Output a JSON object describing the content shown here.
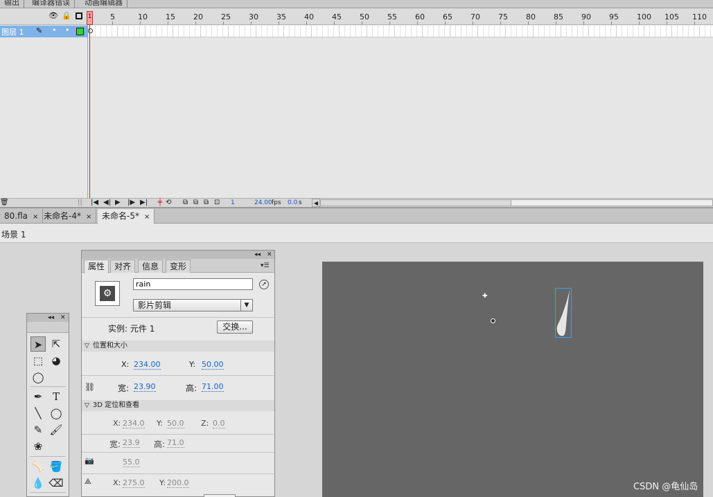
{
  "top_tabs": [
    "输出",
    "编译器错误",
    "动画编辑器"
  ],
  "timeline": {
    "ruler_numbers": [
      1,
      5,
      10,
      15,
      20,
      25,
      30,
      35,
      40,
      45,
      50,
      55,
      60,
      65,
      70,
      75,
      80,
      85,
      90,
      95,
      100,
      105,
      110
    ],
    "playhead_frame": "1",
    "layer": {
      "name": "图层 1"
    },
    "controls": {
      "current_frame": "1",
      "fps": "24.00",
      "fps_unit": "fps",
      "elapsed": "0.0",
      "elapsed_unit": "s"
    }
  },
  "doc_tabs": [
    {
      "label": "80.fla",
      "close": "×"
    },
    {
      "label": "未命名-4*",
      "close": "×"
    },
    {
      "label": "未命名-5*",
      "close": "×"
    }
  ],
  "scene": {
    "label": "场景 1"
  },
  "properties": {
    "tabs": [
      "属性",
      "对齐",
      "信息",
      "变形"
    ],
    "instance_name": "rain",
    "symbol_type": "影片剪辑",
    "instance_label": "实例:",
    "instance_value": "元件 1",
    "swap_button": "交换...",
    "position_section": "位置和大小",
    "pos": {
      "x_label": "X:",
      "x": "234.00",
      "y_label": "Y:",
      "y": "50.00"
    },
    "size": {
      "w_label": "宽:",
      "w": "23.90",
      "h_label": "高:",
      "h": "71.00"
    },
    "position_3d_section": "3D 定位和查看",
    "pos3d": {
      "x_label": "X:",
      "x": "234.0",
      "y_label": "Y:",
      "y": "50.0",
      "z_label": "Z:",
      "z": "0.0"
    },
    "size3d": {
      "w_label": "宽:",
      "w": "23.9",
      "h_label": "高:",
      "h": "71.0"
    },
    "perspective_angle": "55.0",
    "vanishing": {
      "x_label": "X:",
      "x": "275.0",
      "y_label": "Y:",
      "y": "200.0"
    }
  },
  "watermark": "CSDN @龟仙岛",
  "colors": {
    "stage": "#666666",
    "layer_selected": "#7fb2e6",
    "playhead": "#d02020",
    "value_link": "#1a62c4"
  }
}
